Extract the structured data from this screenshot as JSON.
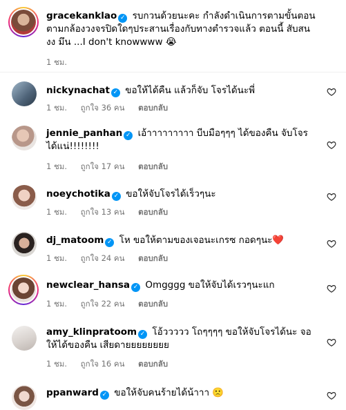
{
  "comments": [
    {
      "username": "gracekanklao",
      "text": "รบกวนด้วยนะคะ กำลังดำเนินการตามขั้นตอน ตามกล้องวงจรปิดใดๆประสานเรื่องกับทางตำรวจแล้ว ตอนนี้ สับสน งง มึน ...I don't knowwww",
      "emoji": "😭",
      "time": "1 ชม.",
      "likes": "",
      "reply": ""
    },
    {
      "username": "nickynachat",
      "text": "ขอให้ได้คืน แล้วก็จับ โจรได้นะพี่",
      "emoji": "",
      "time": "1 ชม.",
      "likes": "ถูกใจ 36 คน",
      "reply": "ตอบกลับ"
    },
    {
      "username": "jennie_panhan",
      "text": "เอ้าาาาาาาาา บีบมือๆๆๆ ได้ของคืน จับโจรได้แน่!!!!!!!!",
      "emoji": "",
      "time": "1 ชม.",
      "likes": "ถูกใจ 17 คน",
      "reply": "ตอบกลับ"
    },
    {
      "username": "noeychotika",
      "text": "ขอให้จับโจรได้เร็วๆนะ",
      "emoji": "",
      "time": "1 ชม.",
      "likes": "ถูกใจ 13 คน",
      "reply": "ตอบกลับ"
    },
    {
      "username": "dj_matoom",
      "text": "โห ขอให้ตามของเจอนะเกรซ กอดๆนะ",
      "emoji": "❤️",
      "time": "1 ชม.",
      "likes": "ถูกใจ 24 คน",
      "reply": "ตอบกลับ"
    },
    {
      "username": "newclear_hansa",
      "text": "Omgggg ขอให้จับได้เรวๆนะแก",
      "emoji": "",
      "time": "1 ชม.",
      "likes": "ถูกใจ 22 คน",
      "reply": "ตอบกลับ"
    },
    {
      "username": "amy_klinpratoom",
      "text": "โอ้ววววว โถๆๆๆๆ ขอให้จับโจรได้นะ จอให้ได้ของคืน เสียดายยยยยยยย",
      "emoji": "",
      "time": "1 ชม.",
      "likes": "ถูกใจ 16 คน",
      "reply": "ตอบกลับ"
    },
    {
      "username": "ppanward",
      "text": "ขอให้จับคนร้ายได้น้าาา",
      "emoji": "🙁",
      "time": "",
      "likes": "",
      "reply": ""
    }
  ],
  "colors": {
    "verified": "#0095f6",
    "meta": "#737373"
  }
}
